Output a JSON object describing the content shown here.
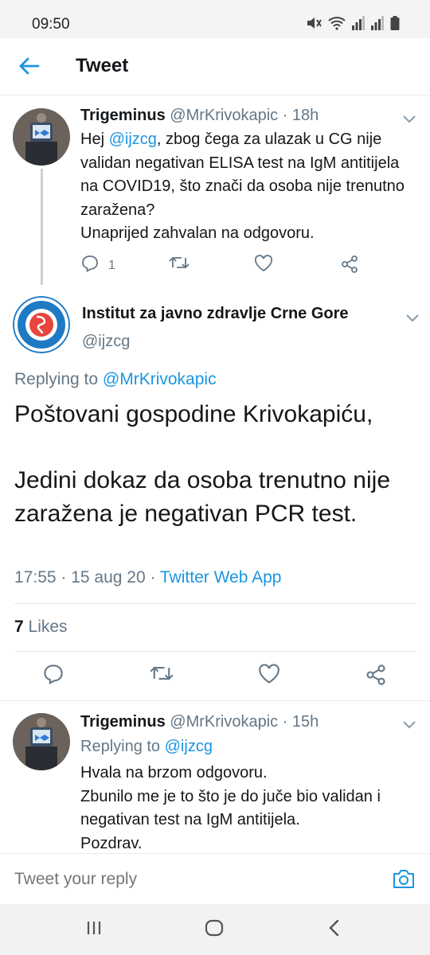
{
  "status_bar": {
    "time": "09:50",
    "icons": [
      "mute-icon",
      "wifi-icon",
      "signal-icon",
      "signal-icon",
      "battery-icon"
    ]
  },
  "header": {
    "title": "Tweet",
    "back_icon": "arrow-left-icon"
  },
  "colors": {
    "accent": "#1b95e0",
    "text": "#14171a",
    "muted": "#657786",
    "divider": "#e6ecf0"
  },
  "parent_tweet": {
    "name": "Trigeminus",
    "handle": "@MrKrivokapic",
    "time": "· 18h",
    "text_pre": "Hej ",
    "mention": "@ijzcg",
    "text_post": ", zbog čega za ulazak u CG nije validan negativan ELISA test na IgM antitijela na COVID19, što znači da osoba nije trenutno zaražena?",
    "text_line2": "Unaprijed zahvalan na odgovoru.",
    "reply_count": "1"
  },
  "main_tweet": {
    "name": "Institut za javno zdravlje Crne Gore",
    "handle": "@ijzcg",
    "replying_prefix": "Replying to ",
    "replying_to": "@MrKrivokapic",
    "para1": "Poštovani gospodine Krivokapiću,",
    "para2": "Jedini dokaz da osoba trenutno nije zaražena je negativan PCR test.",
    "timestamp": "17:55 · 15 aug 20 · ",
    "source": "Twitter Web App",
    "likes_count": "7",
    "likes_label": "Likes"
  },
  "reply_tweet": {
    "name": "Trigeminus",
    "handle": "@MrKrivokapic",
    "time": "· 15h",
    "replying_prefix": "Replying to ",
    "replying_to": "@ijzcg",
    "line1": "Hvala na brzom odgovoru.",
    "line2": "Zbunilo me je to što je do juče bio validan i negativan test na IgM antitijela.",
    "line3": "Pozdrav."
  },
  "reply_bar": {
    "placeholder": "Tweet your reply"
  }
}
